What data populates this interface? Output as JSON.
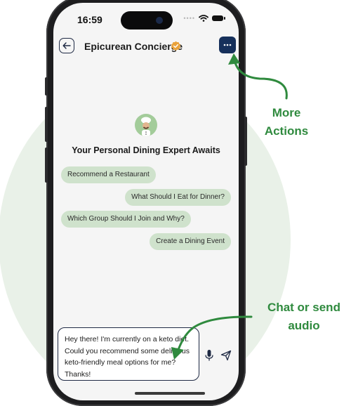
{
  "status_bar": {
    "time": "16:59"
  },
  "header": {
    "title": "Epicurean Concierge",
    "back_icon": "arrow-left-icon",
    "verified_icon": "verified-badge-icon",
    "more_icon": "ellipsis-icon"
  },
  "hero": {
    "avatar_icon": "chef-avatar-icon",
    "title": "Your Personal Dining Expert Awaits"
  },
  "suggestions": [
    "Recommend a Restaurant",
    "What Should I Eat for Dinner?",
    "Which Group Should I Join and Why?",
    "Create a Dining Event"
  ],
  "composer": {
    "message": "Hey there! I'm currently on a keto diet. Could you recommend some delicious keto-friendly meal options for me? Thanks!",
    "mic_icon": "microphone-icon",
    "send_icon": "send-icon"
  },
  "annotations": {
    "more_actions_line1": "More",
    "more_actions_line2": "Actions",
    "chat_line1": "Chat or send",
    "chat_line2": "audio"
  },
  "colors": {
    "accent_green": "#2f8a3e",
    "chip_bg": "#cfe2cc",
    "navy": "#16305b",
    "badge_orange": "#e9a23b"
  }
}
